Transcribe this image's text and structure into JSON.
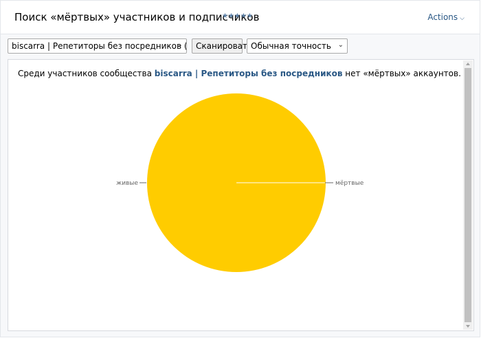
{
  "header": {
    "title": "Поиск «мёртвых» участников и подписчиков",
    "rating": "★★★★★",
    "actions_label": "Actions"
  },
  "toolbar": {
    "group_select_value": "biscarra | Репетиторы без посредников (группа)",
    "scan_button": "Сканировать",
    "accuracy_select_value": "Обычная точность"
  },
  "result": {
    "prefix": "Среди участников сообщества",
    "group_name": "biscarra | Репетиторы без посредников",
    "suffix": "нет «мёртвых» аккаунтов."
  },
  "chart_data": {
    "type": "pie",
    "labels": [
      "живые",
      "мёртвые"
    ],
    "values": [
      100,
      0
    ],
    "colors": [
      "#ffcc00",
      "#ffcc00"
    ]
  }
}
